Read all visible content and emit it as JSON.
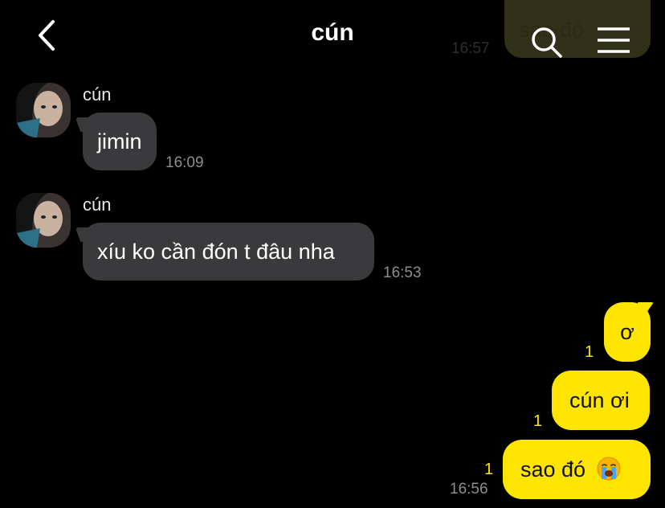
{
  "header": {
    "title": "cún",
    "back_icon": "chevron-left-icon",
    "search_icon": "search-icon",
    "menu_icon": "menu-icon"
  },
  "previous_message_peek": {
    "text": "sao đó",
    "time": "16:57"
  },
  "messages": [
    {
      "direction": "incoming",
      "sender": "cún",
      "text": "jimin",
      "time": "16:09"
    },
    {
      "direction": "incoming",
      "sender": "cún",
      "text": "xíu ko cần đón t đâu nha",
      "time": "16:53"
    },
    {
      "direction": "outgoing",
      "text": "ơ",
      "unread": "1"
    },
    {
      "direction": "outgoing",
      "text": "cún ơi",
      "unread": "1"
    },
    {
      "direction": "outgoing",
      "text": "sao đó",
      "emoji": "loudly-crying-face-icon",
      "unread": "1",
      "time": "16:56"
    }
  ],
  "colors": {
    "background": "#000000",
    "incoming_bubble": "#3a3a3c",
    "outgoing_bubble": "#fee500",
    "unread_count": "#fee500"
  }
}
